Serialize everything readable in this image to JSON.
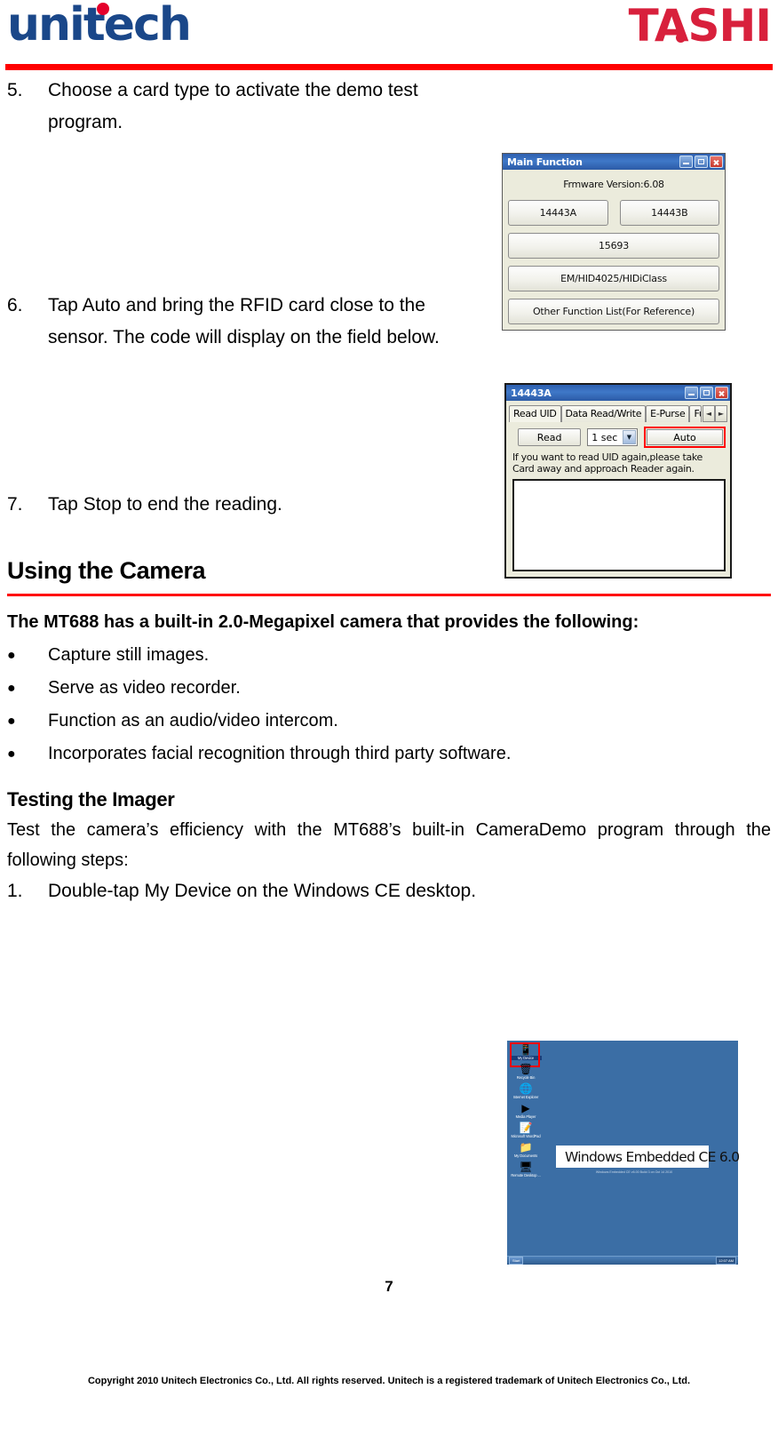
{
  "header": {
    "logo_left": "unitech",
    "logo_right": "TASHI"
  },
  "steps": {
    "step5": {
      "num": "5.",
      "text": "Choose a card type to activate the demo test program."
    },
    "step6": {
      "num": "6.",
      "text": "Tap Auto and bring the RFID card close to the sensor. The code will display on the field below."
    },
    "step7": {
      "num": "7.",
      "text": "Tap Stop to end the reading."
    },
    "step1_camera": {
      "num": "1.",
      "text": "Double-tap My Device on the Windows CE desktop."
    }
  },
  "main_function_window": {
    "title": "Main Function",
    "firmware": "Frmware Version:6.08",
    "buttons": {
      "b14443a": "14443A",
      "b14443b": "14443B",
      "b15693": "15693",
      "bem": "EM/HID4025/HIDiClass",
      "bother": "Other Function List(For Reference)"
    },
    "titlebar": {
      "minimize": "minimize",
      "maximize": "maximize",
      "close": "close"
    }
  },
  "rfid_window": {
    "title": "14443A",
    "tabs": [
      {
        "label": "Read UID"
      },
      {
        "label": "Data Read/Write"
      },
      {
        "label": "E-Purse"
      },
      {
        "label": "Fun"
      }
    ],
    "read_button": "Read",
    "interval_value": "1  sec",
    "auto_button": "Auto",
    "hint": "If you want to read UID again,please take Card away and approach Reader again.",
    "output_value": "",
    "spin_left": "◄",
    "spin_right": "►"
  },
  "camera_section": {
    "heading": "Using the Camera",
    "lead": "The MT688 has a built-in 2.0-Megapixel camera that provides the following:",
    "bullets": [
      "Capture still images.",
      "Serve as video recorder.",
      "Function as an audio/video intercom.",
      "Incorporates facial recognition through third party software."
    ],
    "bullet_glyph": "●"
  },
  "imager_section": {
    "heading": "Testing the Imager",
    "body": "Test the camera’s efficiency with the MT688’s built-in CameraDemo program through the following steps:"
  },
  "ce_desktop": {
    "icons": [
      {
        "label": "My Device",
        "glyph": "📱",
        "selected": true
      },
      {
        "label": "Recycle Bin",
        "glyph": "🗑",
        "selected": false
      },
      {
        "label": "Internet Explorer",
        "glyph": "🌐",
        "selected": false
      },
      {
        "label": "Media Player",
        "glyph": "▶",
        "selected": false
      },
      {
        "label": "Microsoft WordPad",
        "glyph": "📝",
        "selected": false
      },
      {
        "label": "My Documents",
        "glyph": "📁",
        "selected": false
      },
      {
        "label": "Remote Desktop ...",
        "glyph": "🖥",
        "selected": false
      }
    ],
    "banner_text": "Windows Embedded CE 6.0",
    "build_text": "Windows Embedded CE v6.00  Build 3 on Oct 14 2010",
    "start_label": "Start",
    "clock": "12:07 AM"
  },
  "page_number": "7",
  "footer": "Copyright 2010 Unitech Electronics Co., Ltd. All rights reserved. Unitech is a registered trademark of Unitech Electronics Co., Ltd.",
  "colors": {
    "brand_blue": "#1a4789",
    "brand_red": "#e4002b",
    "tashi_red": "#d8203c",
    "rule_red": "#ff0000",
    "ce_desktop_blue": "#3b6ea5"
  }
}
